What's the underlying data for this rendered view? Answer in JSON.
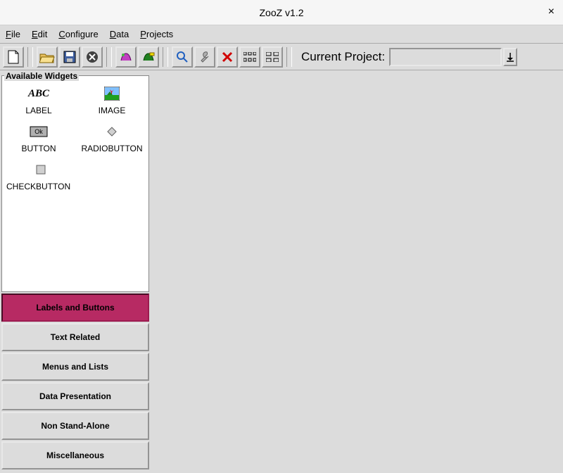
{
  "window": {
    "title": "ZooZ v1.2"
  },
  "menu": {
    "file": "File",
    "edit": "Edit",
    "configure": "Configure",
    "data": "Data",
    "projects": "Projects"
  },
  "toolbar": {
    "project_label": "Current Project:",
    "project_value": ""
  },
  "sidebar": {
    "title": "Available Widgets",
    "widgets": [
      {
        "name": "LABEL"
      },
      {
        "name": "IMAGE"
      },
      {
        "name": "BUTTON"
      },
      {
        "name": "RADIOBUTTON"
      },
      {
        "name": "CHECKBUTTON"
      }
    ],
    "categories": [
      {
        "label": "Labels and Buttons",
        "active": true
      },
      {
        "label": "Text Related",
        "active": false
      },
      {
        "label": "Menus and Lists",
        "active": false
      },
      {
        "label": "Data Presentation",
        "active": false
      },
      {
        "label": "Non Stand-Alone",
        "active": false
      },
      {
        "label": "Miscellaneous",
        "active": false
      }
    ]
  }
}
